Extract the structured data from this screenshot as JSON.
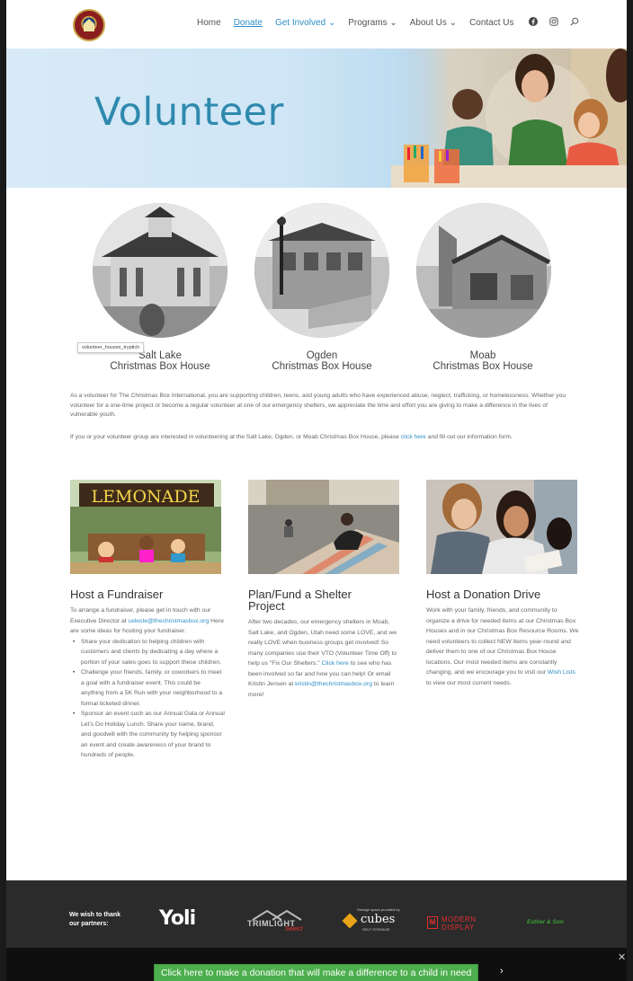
{
  "nav": {
    "items": [
      {
        "label": "Home",
        "state": "normal"
      },
      {
        "label": "Donate",
        "state": "active"
      },
      {
        "label": "Get Involved ⌄",
        "state": "current"
      },
      {
        "label": "Programs ⌄",
        "state": "normal"
      },
      {
        "label": "About Us ⌄",
        "state": "normal"
      },
      {
        "label": "Contact Us",
        "state": "normal"
      }
    ],
    "icons": [
      "facebook-icon",
      "instagram-icon",
      "search-icon"
    ]
  },
  "hero": {
    "title": "Volunteer"
  },
  "houses": {
    "tooltip": "volunteer_houses_tryptich",
    "items": [
      {
        "line1": "Salt Lake",
        "line2": "Christmas Box House"
      },
      {
        "line1": "Ogden",
        "line2": "Christmas Box House"
      },
      {
        "line1": "Moab",
        "line2": "Christmas Box House"
      }
    ]
  },
  "intro": {
    "p1": "As a volunteer for The Christmas Box International, you are supporting children, teens, and young adults who have experienced abuse, neglect, trafficking, or homelessness. Whether you volunteer for a one-time project or become a regular volunteer at one of our emergency shelters, we appreciate the time and effort you are giving to make a difference in the lives of vulnerable youth.",
    "p2_before": "If you or your volunteer group are interested in volunteering at the Salt Lake, Ogden, or Moab Christmas Box House, please ",
    "p2_link": "click here",
    "p2_after": " and fill out our information form."
  },
  "columns": {
    "fundraiser": {
      "image_sign": "LEMONADE",
      "title": "Host a Fundraiser",
      "intro_before": "To arrange a fundraiser, please get in touch with our Executive Director at ",
      "email": "celeste@thechristmasbox.org",
      "intro_after": " Here are some ideas for hosting your fundraiser.",
      "bullets": [
        "Share your dedication to helping children with customers and clients by dedicating a day where a portion of your sales goes to support these children.",
        "Challenge your friends, family, or coworkers to meet a goal with a fundraiser event. This could be anything from a 5K Run with your neighborhood to a formal ticketed dinner.",
        "Sponsor an event such as our Annual Gala or Annual Let's Do Holiday Lunch. Share your name, brand, and goodwill with the community by helping sponsor an event and create awareness of your brand to hundreds of people."
      ]
    },
    "shelter": {
      "title_line1": "Plan/Fund a Shelter",
      "title_line2": "Project",
      "text_before": "After two decades, our emergency shelters in Moab, Salt Lake, and Ogden, Utah need some LOVE, and we really LOVE when business groups get involved! So many companies use their VTO (Volunteer Time Off) to help us \"Fix Our Shelters.\" ",
      "link": "Click here",
      "text_mid": " to see who has been involved so far and how you can help! Or email Kristin Jensen at ",
      "email": "kristin@thechristmasbox.org",
      "text_after": " to learn more!"
    },
    "drive": {
      "title": "Host a Donation Drive",
      "text_before": "Work with your family, friends, and community to organize a drive for needed items at our Christmas Box Houses and in our Christmas Box Resource Rooms. We need volunteers to collect NEW items year-round and deliver them to one of our Christmas Box House locations. Our most needed items are constantly changing, and we encourage you to visit our ",
      "link": "Wish Lists",
      "text_after": " to view our most current needs."
    }
  },
  "footer": {
    "thanks_line1": "We wish to thank",
    "thanks_line2": "our partners:",
    "partners": {
      "yoli": "Yoli",
      "trimlight": "TRIMLIGHT",
      "trimlight_sub": "Select",
      "cubes_top": "Storage space provided by",
      "cubes": "cubes",
      "cubes_sub": "SELF STORAGE",
      "modern": "MODERN",
      "display": "DISPLAY",
      "esther": "Esther & Son"
    }
  },
  "banner": {
    "cta": "Click here to make a donation that will make a difference to a child in need",
    "arrow": "›",
    "close": "✕"
  },
  "colors": {
    "accent": "#2e8ec7",
    "hero_title": "#2e89ad",
    "cta_green": "#4cae4c",
    "footer_bg": "#2b2b2b"
  }
}
